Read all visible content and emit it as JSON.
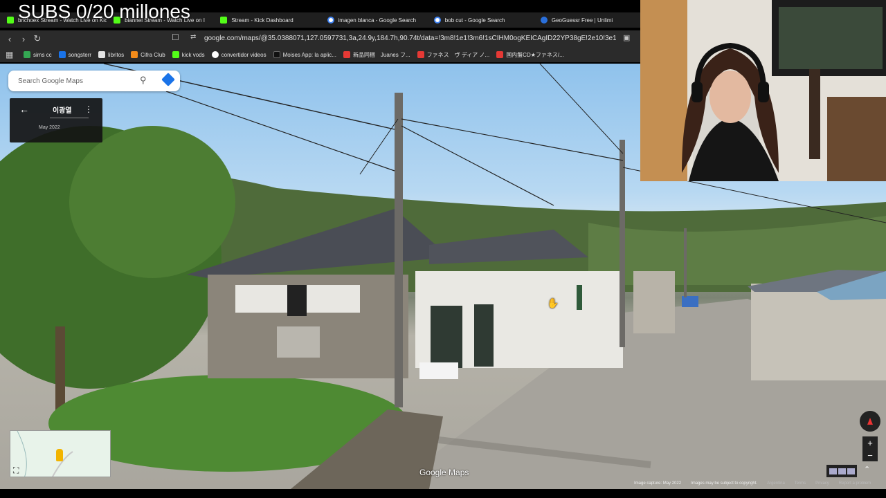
{
  "overlay": {
    "subs_text": "SUBS 0/20 millones"
  },
  "tabs": [
    {
      "label": "brichoex Stream - Watch Live on Kick",
      "icon": "kick-icon"
    },
    {
      "label": "biannel Stream - Watch Live on I",
      "icon": "kick-icon"
    },
    {
      "label": "Stream - Kick Dashboard",
      "icon": "kick-icon"
    },
    {
      "label": "imagen blanca - Google Search",
      "icon": "google-icon"
    },
    {
      "label": "bob cut - Google Search",
      "icon": "google-icon"
    },
    {
      "label": "GeoGuessr Free | Unlimi",
      "icon": "geoguessr-icon"
    }
  ],
  "address_bar": {
    "url": "google.com/maps/@35.0388071,127.0597731,3a,24.9y,184.7h,90.74t/data=!3m8!1e1!3m6!1sCIHM0ogKEICAgID22YP38gE!2e10!3e11!6shttps:%..."
  },
  "bookmarks": [
    {
      "label": "sims cc",
      "color": "#34a853"
    },
    {
      "label": "songsterr",
      "color": "#1a73e8"
    },
    {
      "label": "libritos",
      "color": "#e3e3e3"
    },
    {
      "label": "Cifra Club",
      "color": "#f28b1a"
    },
    {
      "label": "kick vods",
      "color": "#53fc18"
    },
    {
      "label": "convertidor videos",
      "color": "#ffffff"
    },
    {
      "label": "Moises App: la aplic...",
      "color": "#111111"
    },
    {
      "label": "新品同梱　Juanes フ...",
      "color": "#e53935"
    },
    {
      "label": "ファネス　ヴ ディア ノ...",
      "color": "#e53935"
    },
    {
      "label": "国内盤CD★ファネス/...",
      "color": "#e53935"
    }
  ],
  "maps": {
    "search_placeholder": "Search Google Maps",
    "location_name": "이광열",
    "capture_date": "May 2022",
    "brand": "Google Maps",
    "footer": {
      "image_capture": "Image capture: May 2022",
      "copyright": "Images may be subject to copyright.",
      "country": "Argentina",
      "terms": "Terms",
      "privacy": "Privacy",
      "report": "Report a problem"
    }
  },
  "colors": {
    "kick": "#53fc18",
    "chrome_dark": "#2b2b2b",
    "maps_blue": "#1a73e8"
  }
}
